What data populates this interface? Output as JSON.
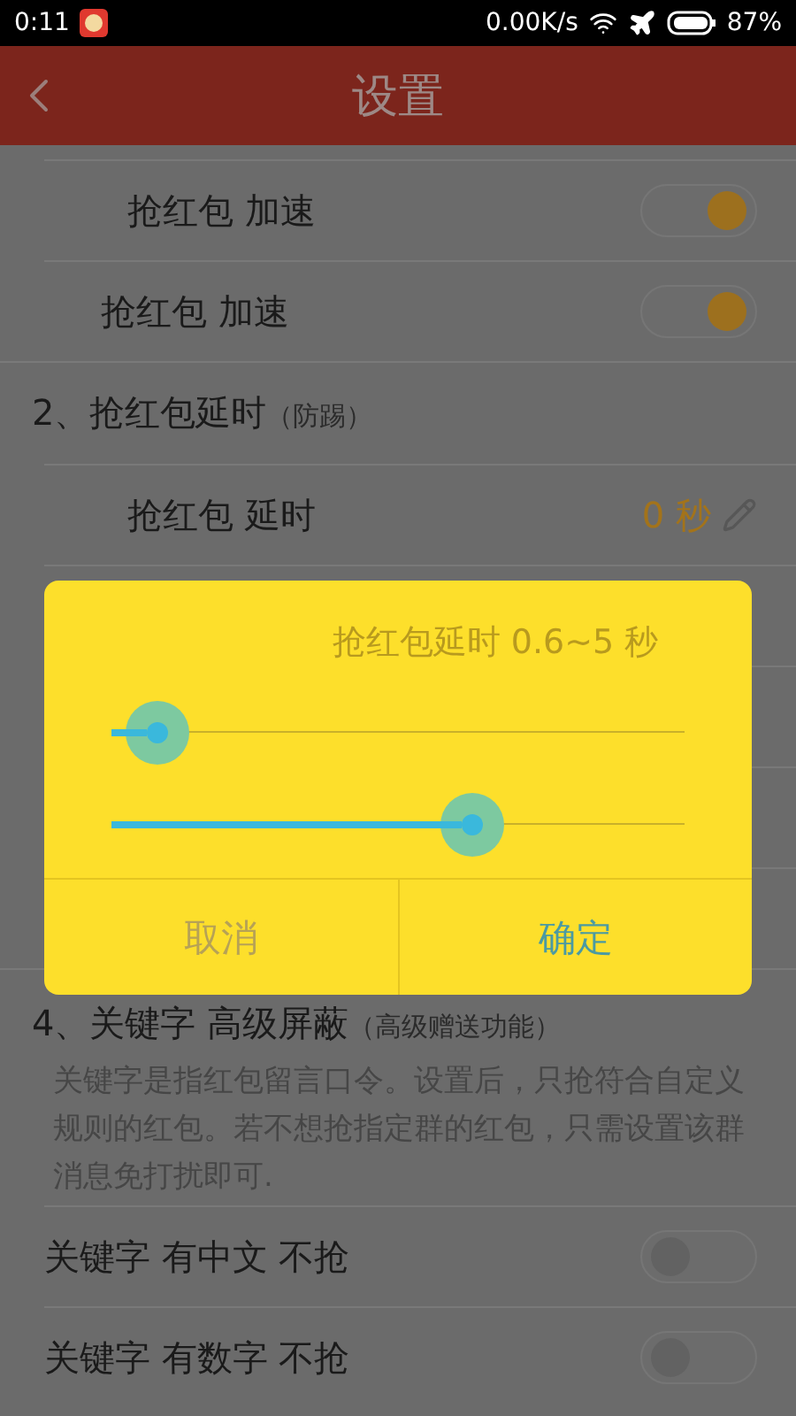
{
  "status_bar": {
    "time": "0:11",
    "speed": "0.00K/s",
    "battery": "87%"
  },
  "header": {
    "title": "设置"
  },
  "sections": [
    {
      "kind": "group",
      "items": [
        {
          "kind": "toggle",
          "label": "抢红包 加速",
          "on": true,
          "indented": true
        },
        {
          "kind": "toggle",
          "label": "抢红包 加速",
          "on": true,
          "indented": false
        }
      ]
    },
    {
      "kind": "group",
      "title": "2、抢红包延时",
      "note": "（防踢）",
      "items": [
        {
          "kind": "value",
          "label": "抢红包 延时",
          "value": "0 秒",
          "indented": true
        },
        {
          "kind": "hidden"
        }
      ]
    },
    {
      "kind": "group",
      "items": [
        {
          "kind": "hidden"
        },
        {
          "kind": "hidden"
        },
        {
          "kind": "hidden"
        }
      ]
    },
    {
      "kind": "flat",
      "title": "4、关键字 高级屏蔽",
      "note": "（高级赠送功能）",
      "description": "关键字是指红包留言口令。设置后，只抢符合自定义规则的红包。若不想抢指定群的红包，只需设置该群消息免打扰即可.",
      "items": [
        {
          "kind": "toggle",
          "label": "关键字 有中文 不抢",
          "on": false
        },
        {
          "kind": "toggle",
          "label": "关键字 有数字 不抢",
          "on": false
        }
      ]
    }
  ],
  "dialog": {
    "title": "抢红包延时 0.6~5 秒",
    "sliders": [
      {
        "level": 0.08
      },
      {
        "level": 0.63
      }
    ],
    "buttons": [
      {
        "label": "取消",
        "kind": "cancel"
      },
      {
        "label": "确定",
        "kind": "ok"
      }
    ]
  }
}
